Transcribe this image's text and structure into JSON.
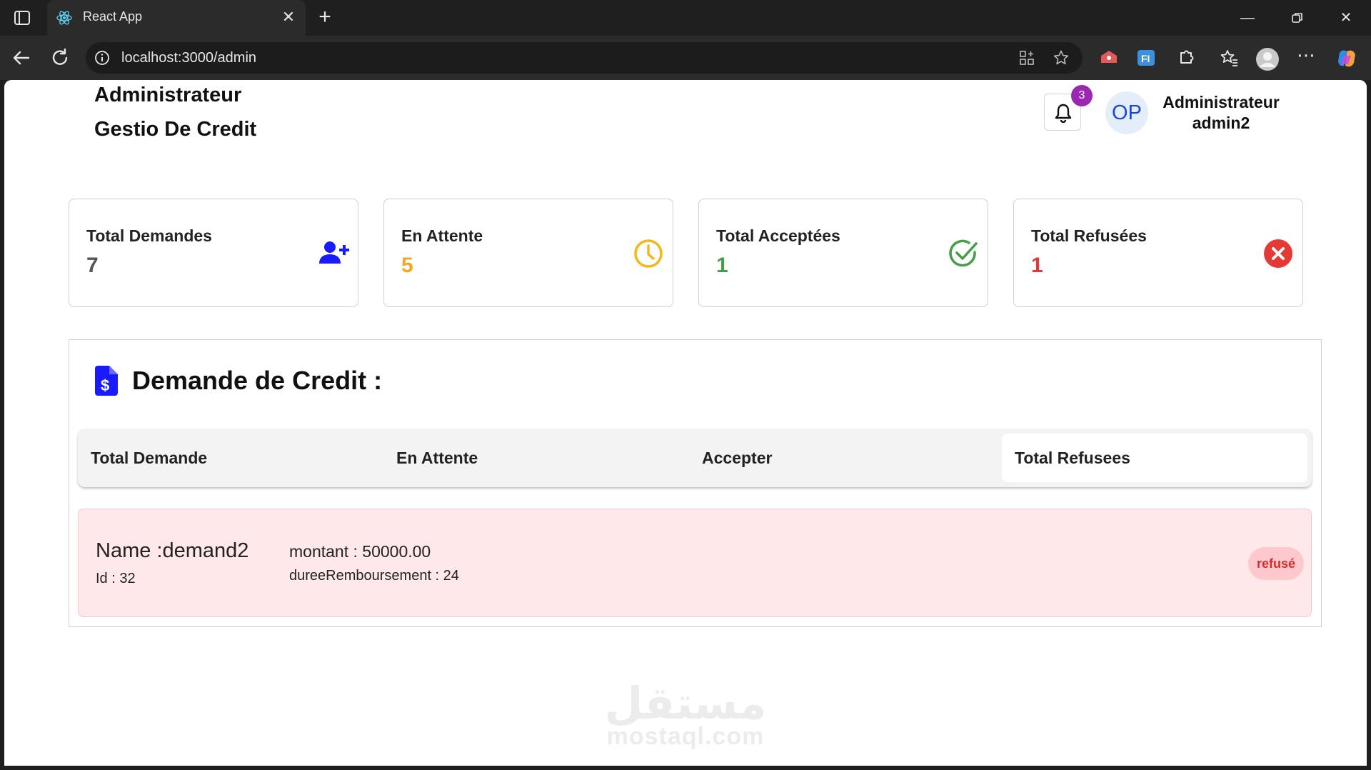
{
  "browser": {
    "tab_title": "React App",
    "url": "localhost:3000/admin",
    "icons": [
      "sidebar-toggle-icon",
      "react-favicon-icon",
      "close-icon",
      "plus-icon",
      "minimize-icon",
      "restore-icon",
      "close-window-icon",
      "back-icon",
      "reload-icon",
      "info-icon",
      "app-install-icon",
      "star-icon",
      "extension-icon",
      "favorites-icon",
      "profile-icon",
      "more-icon",
      "copilot-icon"
    ]
  },
  "header": {
    "brand_line1": "Administrateur",
    "brand_line2": "Gestio De Credit",
    "notification_count": "3",
    "avatar_initials": "OP",
    "user_role": "Administrateur",
    "user_name": "admin2"
  },
  "stats": [
    {
      "label": "Total Demandes",
      "value": "7",
      "color": "#555555",
      "icon": "user-plus-icon"
    },
    {
      "label": "En Attente",
      "value": "5",
      "color": "#f5a623",
      "icon": "clock-icon"
    },
    {
      "label": "Total Acceptées",
      "value": "1",
      "color": "#43a047",
      "icon": "check-circle-icon"
    },
    {
      "label": "Total Refusées",
      "value": "1",
      "color": "#e53935",
      "icon": "x-circle-icon"
    }
  ],
  "panel": {
    "title": "Demande de Credit :",
    "tabs": [
      "Total Demande",
      "En Attente",
      "Accepter",
      "Total Refusees"
    ],
    "active_tab": "Total Refusees"
  },
  "request": {
    "name": "Name :demand2",
    "id": "Id : 32",
    "amount": "montant : 50000.00",
    "duration": "dureeRemboursement : 24",
    "status": "refusé"
  },
  "watermark": {
    "arabic": "مستقل",
    "latin": "mostaql.com"
  },
  "colors": {
    "accent_blue": "#1a1aff",
    "pending": "#f5a623",
    "accepted": "#43a047",
    "refused": "#e53935",
    "badge": "#9c27b0",
    "request_bg": "#ffe8ea"
  }
}
